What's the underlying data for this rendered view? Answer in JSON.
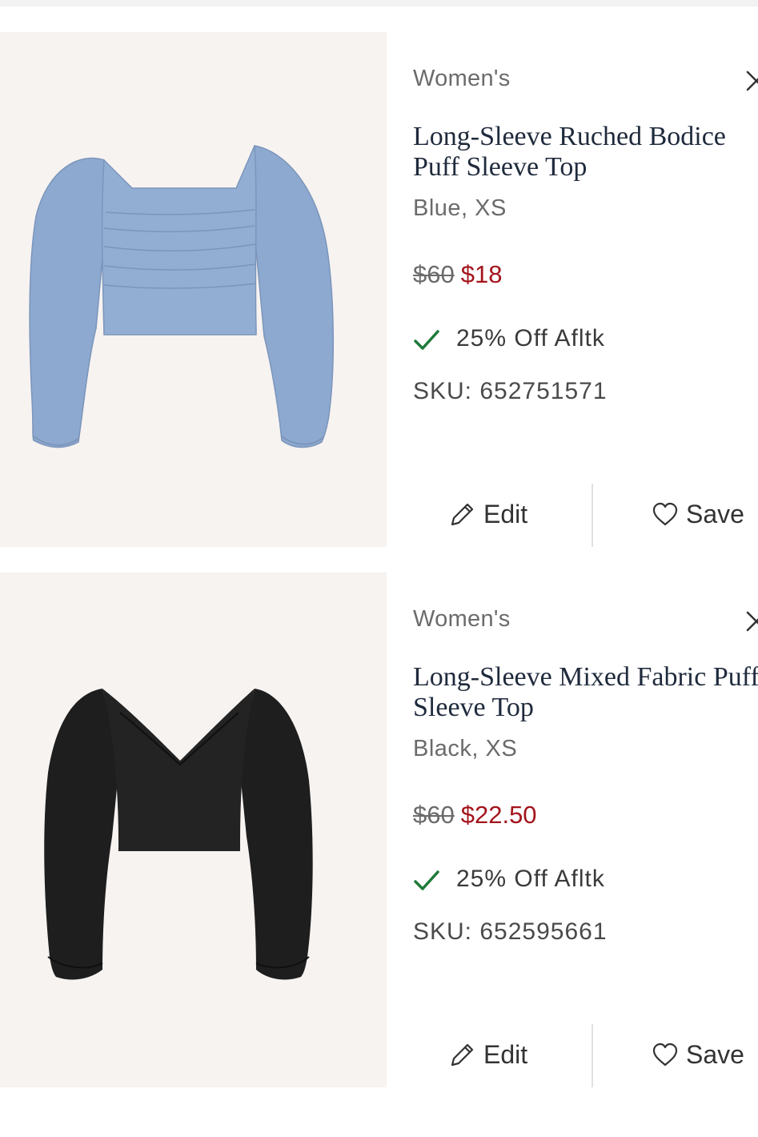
{
  "items": [
    {
      "department": "Women's",
      "name_lines": [
        "Long-Sleeve Ruched Bodice",
        "Puff Sleeve Top"
      ],
      "variant": "Blue, XS",
      "original_price": "$60",
      "sale_price": "$18",
      "promo": "25% Off Afltk",
      "sku": "SKU: 652751571",
      "edit_label": "Edit",
      "save_label": "Save",
      "garment_color": "#8ea9cf"
    },
    {
      "department": "Women's",
      "name_lines": [
        "Long-Sleeve Mixed Fabric Puff",
        "Sleeve Top"
      ],
      "variant": "Black, XS",
      "original_price": "$60",
      "sale_price": "$22.50",
      "promo": "25% Off Afltk",
      "sku": "SKU: 652595661",
      "edit_label": "Edit",
      "save_label": "Save",
      "garment_color": "#1e1e1e"
    }
  ],
  "colors": {
    "sale": "#a3141c",
    "check": "#1f7a3a",
    "name": "#1f2a3c",
    "muted": "#6b6b6b",
    "photo_bg": "#f7f3f1"
  },
  "icons": [
    "close-icon",
    "check-icon",
    "pencil-icon",
    "heart-icon"
  ]
}
